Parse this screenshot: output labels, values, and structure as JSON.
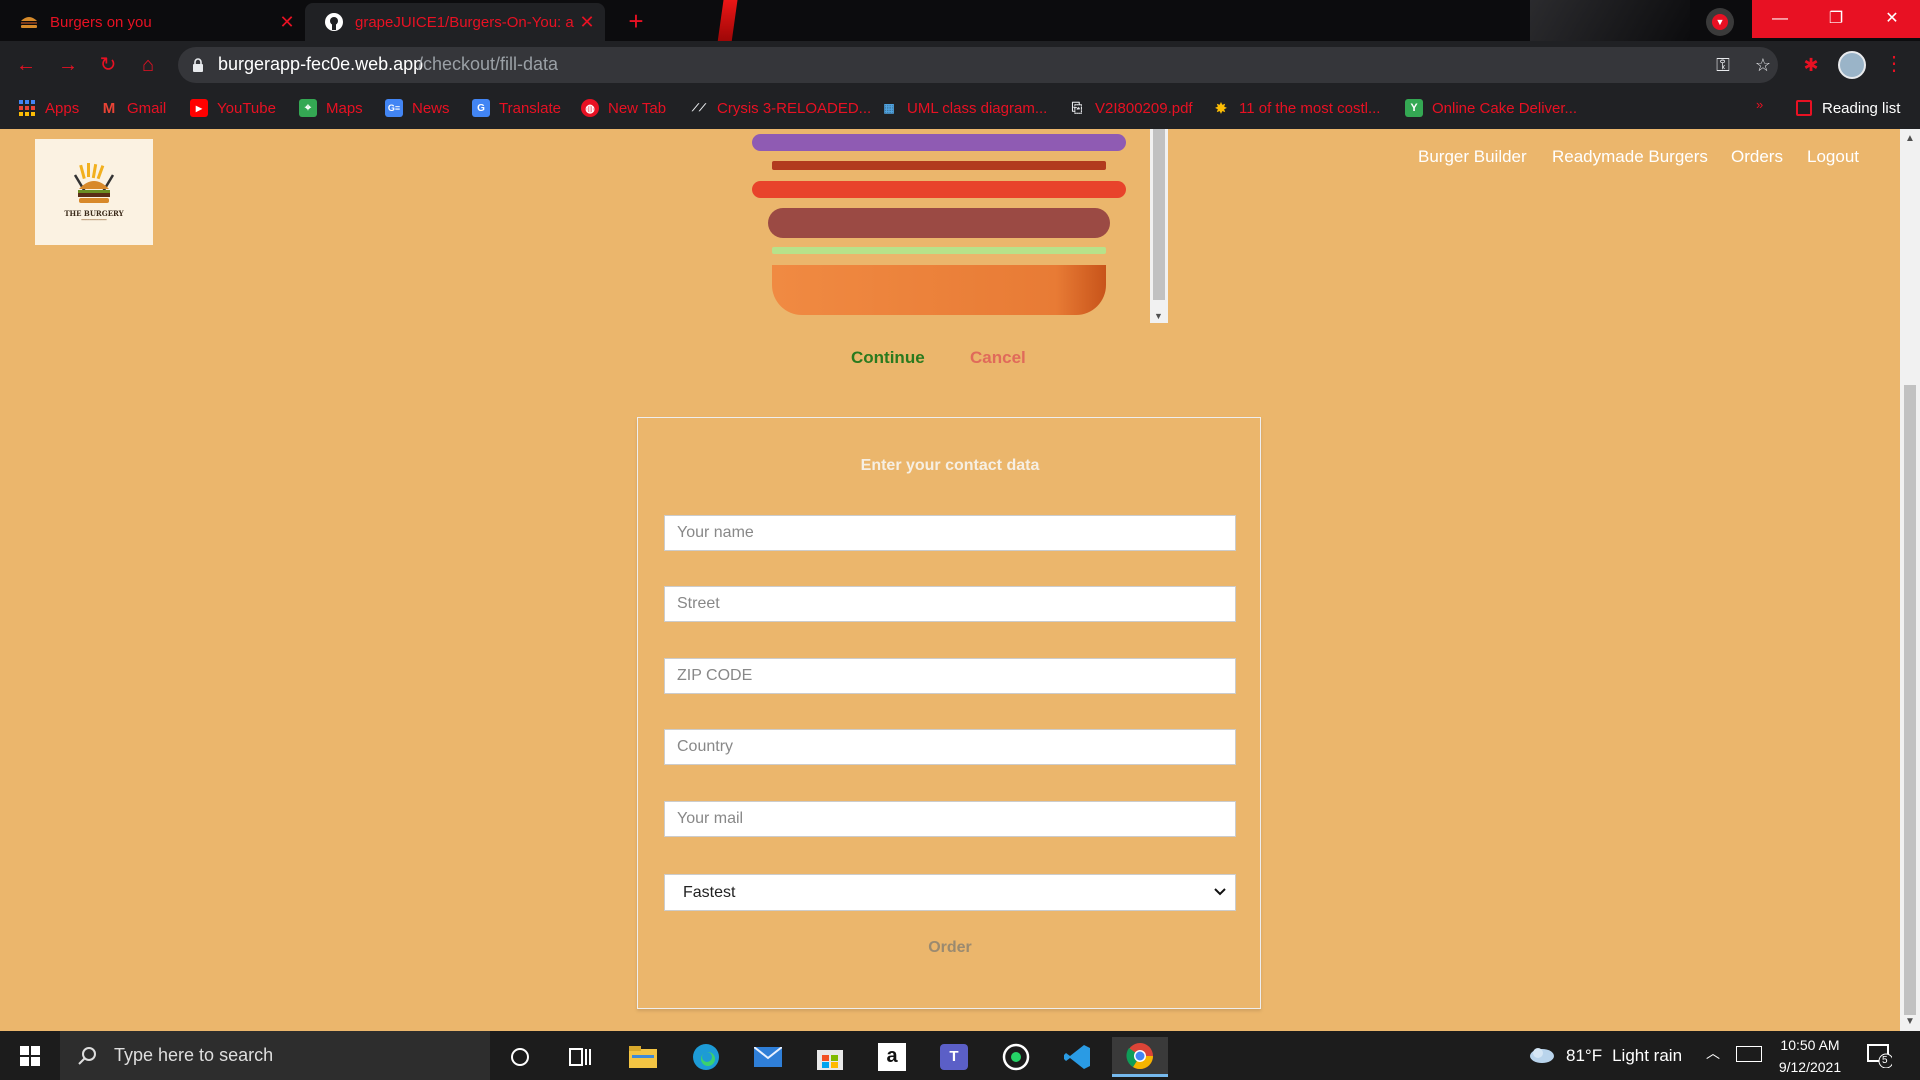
{
  "browser": {
    "tabs": [
      {
        "title": "Burgers on you",
        "close": "✕"
      },
      {
        "title": "grapeJUICE1/Burgers-On-You: a",
        "close": "✕"
      }
    ],
    "new_tab": "+",
    "url": {
      "host": "burgerapp-fec0e.web.app",
      "path": "/checkout/fill-data"
    },
    "bookmarks": [
      {
        "label": "Apps",
        "icon": "apps-grid-icon"
      },
      {
        "label": "Gmail",
        "icon": "gmail-icon"
      },
      {
        "label": "YouTube",
        "icon": "youtube-icon"
      },
      {
        "label": "Maps",
        "icon": "maps-icon"
      },
      {
        "label": "News",
        "icon": "news-icon"
      },
      {
        "label": "Translate",
        "icon": "translate-icon"
      },
      {
        "label": "New Tab",
        "icon": "globe-icon"
      },
      {
        "label": "Crysis 3-RELOADED...",
        "icon": "crysis-icon"
      },
      {
        "label": "UML class diagram...",
        "icon": "uml-icon"
      },
      {
        "label": "V2I800209.pdf",
        "icon": "pdf-icon"
      },
      {
        "label": "11 of the most costl...",
        "icon": "article-icon"
      },
      {
        "label": "Online Cake Deliver...",
        "icon": "cake-icon"
      }
    ],
    "reading_list": "Reading list"
  },
  "app": {
    "logo_text": "THE BURGERY",
    "nav": [
      "Burger Builder",
      "Readymade Burgers",
      "Orders",
      "Logout"
    ],
    "checkout": {
      "continue": "Continue",
      "cancel": "Cancel"
    },
    "form": {
      "title": "Enter your contact data",
      "fields": [
        {
          "placeholder": "Your name"
        },
        {
          "placeholder": "Street"
        },
        {
          "placeholder": "ZIP CODE"
        },
        {
          "placeholder": "Country"
        },
        {
          "placeholder": "Your mail"
        }
      ],
      "delivery_method": "Fastest",
      "order_button": "Order"
    }
  },
  "taskbar": {
    "search_placeholder": "Type here to search",
    "weather": {
      "temp": "81°F",
      "condition": "Light rain"
    },
    "time": "10:50 AM",
    "date": "9/12/2021",
    "notifications": "5"
  },
  "colors": {
    "page_bg": "#ebb66c",
    "accent_red": "#e81123",
    "continue_green": "#2a7a1e",
    "cancel_red": "#e06a5a"
  }
}
